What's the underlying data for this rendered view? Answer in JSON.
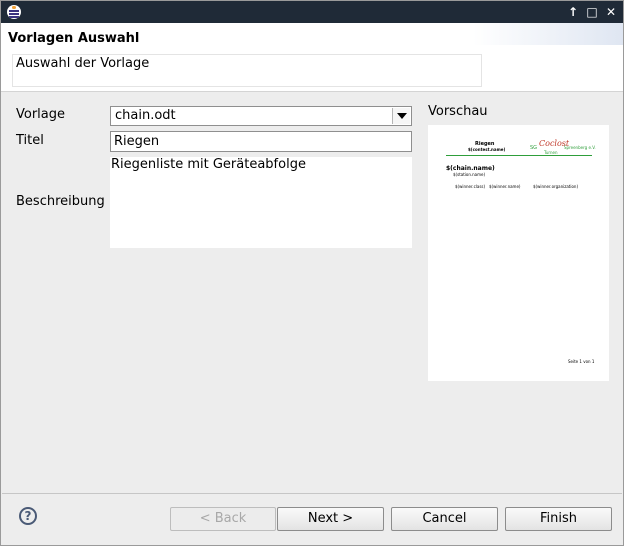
{
  "window": {
    "title_icon": "eclipse-app-icon",
    "buttons": {
      "maximize": "↑",
      "restore": "□",
      "close": "✕"
    }
  },
  "header": {
    "title": "Vorlagen Auswahl",
    "message": "Auswahl der Vorlage"
  },
  "form": {
    "vorlage_label": "Vorlage",
    "vorlage_value": "chain.odt",
    "titel_label": "Titel",
    "titel_value": "Riegen",
    "beschreibung_label": "Beschreibung",
    "beschreibung_value": "Riegenliste mit Geräteabfolge"
  },
  "preview": {
    "label": "Vorschau",
    "doc_title": "Riegen",
    "doc_subtitle": "$(contest.name)",
    "logo_prefix": "SG",
    "logo_script": "Coclost",
    "logo_club": "Spreenberg e.V.",
    "logo_sub": "Turnen",
    "chain_name": "$(chain.name)",
    "station_name": "$(station.name)",
    "col1": "$(winner.class)",
    "col2": "$(winner.name)",
    "col3": "$(winner.organization)",
    "footer": "Seite 1 von 1"
  },
  "buttons": {
    "help": "?",
    "back": "< Back",
    "next": "Next >",
    "cancel": "Cancel",
    "finish": "Finish"
  },
  "colors": {
    "titlebar": "#1f2a37",
    "preview_accent_red": "#c0392b",
    "preview_accent_green": "#2e9e3a"
  }
}
